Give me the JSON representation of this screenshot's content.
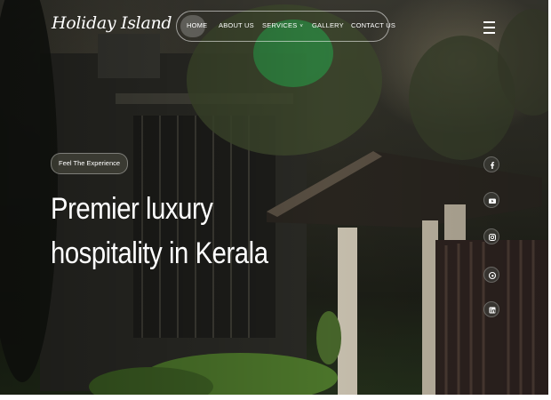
{
  "brand": {
    "logo_text": "Holiday Island"
  },
  "nav": {
    "items": [
      {
        "label": "HOME"
      },
      {
        "label": "ABOUT US"
      },
      {
        "label": "SERVICES"
      },
      {
        "label": "GALLERY"
      },
      {
        "label": "CONTACT US"
      }
    ],
    "active": "HOME",
    "services_caret": "˅"
  },
  "hero": {
    "tag": "Feel The Experience",
    "headline_line1": "Premier luxury",
    "headline_line2": "hospitality in Kerala"
  },
  "social": {
    "icons": [
      "facebook-icon",
      "youtube-icon",
      "instagram-icon",
      "threads-icon",
      "linkedin-icon"
    ]
  },
  "colors": {
    "text": "#ffffff",
    "nav_active_bg": "rgba(255,255,255,0.22)",
    "accent_green": "#28a046"
  }
}
